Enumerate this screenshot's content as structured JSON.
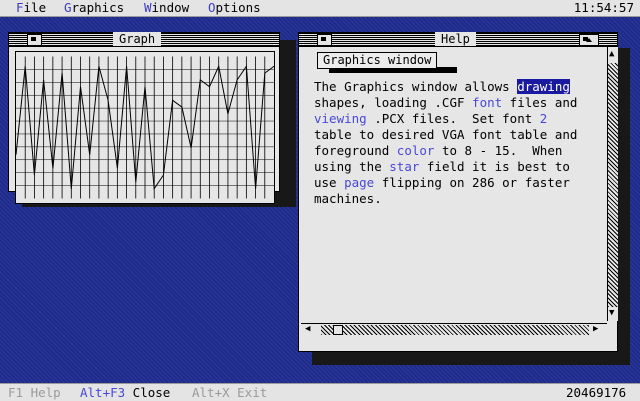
{
  "menubar": {
    "items": [
      {
        "hotkey": "F",
        "rest": "ile"
      },
      {
        "hotkey": "G",
        "rest": "raphics"
      },
      {
        "hotkey": "W",
        "rest": "indow"
      },
      {
        "hotkey": "O",
        "rest": "ptions"
      }
    ],
    "clock": "11:54:57"
  },
  "graph_window": {
    "title": "Graph",
    "series": [
      0.3,
      0.95,
      0.15,
      0.85,
      0.2,
      0.9,
      0.05,
      0.8,
      0.3,
      0.95,
      0.7,
      0.2,
      0.95,
      0.1,
      0.8,
      0.05,
      0.15,
      0.7,
      0.65,
      0.35,
      0.85,
      0.8,
      0.95,
      0.6,
      0.85,
      0.95,
      0.05,
      0.9,
      0.95
    ]
  },
  "help_window": {
    "title": "Help",
    "section_label": "Graphics window",
    "text": {
      "l1_a": "The Graphics window allows ",
      "l1_sel": "drawing",
      "l2_a": "shapes, loading .CGF ",
      "l2_link": "font",
      "l2_b": " files and",
      "l3_link": "viewing",
      "l3_a": " .PCX files.  Set font ",
      "l3_link2": "2",
      "l4": "table to desired VGA font table and",
      "l5_a": "foreground ",
      "l5_link": "color",
      "l5_b": " to 8 - 15.  When",
      "l6_a": "using the ",
      "l6_link": "star",
      "l6_b": " field it is best to",
      "l7_a": "use ",
      "l7_link": "page",
      "l7_b": " flipping on 286 or faster",
      "l8": "machines."
    }
  },
  "statusbar": {
    "f1_help": "F1 Help",
    "alt_f3_key": "Alt+F3",
    "alt_f3_label": " Close",
    "alt_x_exit": "Alt+X Exit",
    "memory": "20469176"
  },
  "colors": {
    "desktop": "#1e2a8c",
    "menu_bg": "#e4e4e4",
    "window_bg": "#e6e6e6",
    "hotkey": "#3c3cc0",
    "link": "#4848d8",
    "selection": "#1a1aa0"
  },
  "icons": {
    "close_box": "square-close-icon",
    "zoom": "up-triangle-icon",
    "scroll_up": "up-arrow-icon",
    "scroll_down": "down-arrow-icon",
    "scroll_left": "left-arrow-icon",
    "scroll_right": "right-arrow-icon"
  }
}
